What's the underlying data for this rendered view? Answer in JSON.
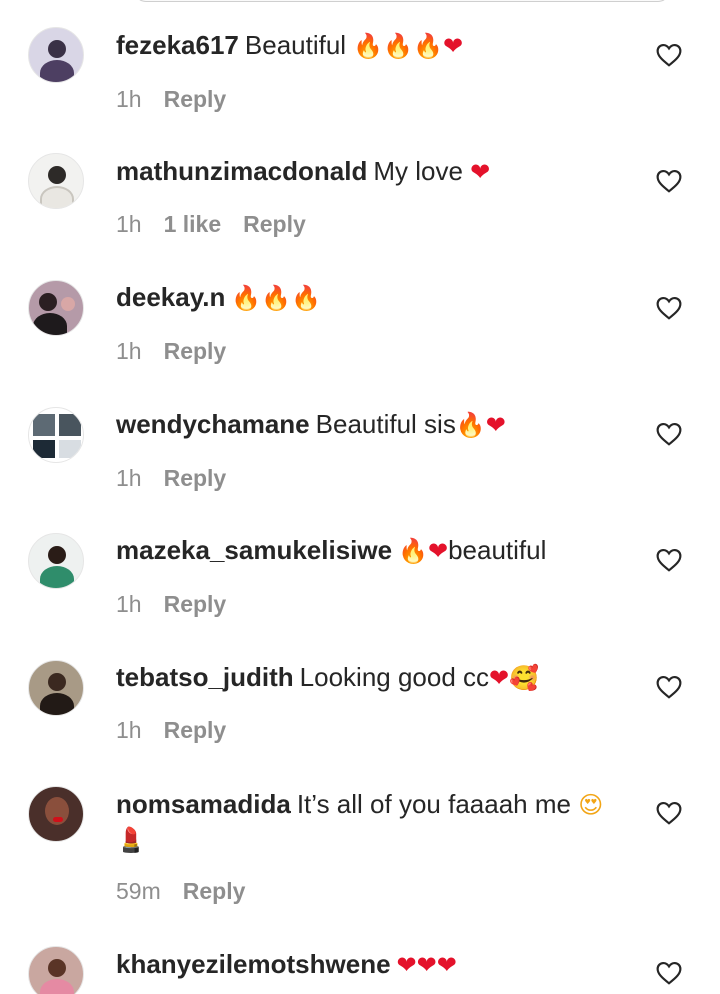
{
  "comments": [
    {
      "username": "fezeka617",
      "text": "Beautiful ",
      "emojis": [
        {
          "char": "🔥",
          "kind": "fire"
        },
        {
          "char": "🔥",
          "kind": "fire"
        },
        {
          "char": "🔥",
          "kind": "fire"
        },
        {
          "char": "❤",
          "kind": "heart"
        }
      ],
      "time": "1h",
      "likes": "",
      "reply": "Reply"
    },
    {
      "username": "mathunzimacdonald",
      "text": "My love ",
      "emojis": [
        {
          "char": "❤",
          "kind": "heart"
        }
      ],
      "time": "1h",
      "likes": "1 like",
      "reply": "Reply"
    },
    {
      "username": "deekay.n",
      "text": "",
      "emojis": [
        {
          "char": "🔥",
          "kind": "fire"
        },
        {
          "char": "🔥",
          "kind": "fire"
        },
        {
          "char": "🔥",
          "kind": "fire"
        }
      ],
      "time": "1h",
      "likes": "",
      "reply": "Reply"
    },
    {
      "username": "wendychamane",
      "text": "Beautiful sis",
      "emojis": [
        {
          "char": "🔥",
          "kind": "fire"
        },
        {
          "char": "❤",
          "kind": "heart"
        }
      ],
      "time": "1h",
      "likes": "",
      "reply": "Reply"
    },
    {
      "username": "mazeka_samukelisiwe",
      "text": "",
      "emojis": [
        {
          "char": "🔥",
          "kind": "fire"
        },
        {
          "char": "❤",
          "kind": "heart"
        }
      ],
      "suffix": "beautiful",
      "time": "1h",
      "likes": "",
      "reply": "Reply"
    },
    {
      "username": "tebatso_judith",
      "text": "Looking good cc",
      "emojis": [
        {
          "char": "❤",
          "kind": "heart"
        },
        {
          "char": "🥰",
          "kind": "smile"
        }
      ],
      "time": "1h",
      "likes": "",
      "reply": "Reply"
    },
    {
      "username": "nomsamadida",
      "text": "It’s all of you faaaah me ",
      "emojis": [
        {
          "char": "😍",
          "kind": "smile"
        },
        {
          "char": "💄",
          "kind": "lipstick"
        }
      ],
      "time": "59m",
      "likes": "",
      "reply": "Reply"
    },
    {
      "username": "khanyezilemotshwene",
      "text": "",
      "emojis": [
        {
          "char": "❤",
          "kind": "heart"
        },
        {
          "char": "❤",
          "kind": "heart"
        },
        {
          "char": "❤",
          "kind": "heart"
        }
      ],
      "time": "",
      "likes": "",
      "reply": ""
    }
  ],
  "colors": {
    "text": "#262626",
    "meta": "#8e8e8e",
    "heart_outline": "#262626"
  },
  "icons": {
    "like": "heart-outline-icon"
  }
}
